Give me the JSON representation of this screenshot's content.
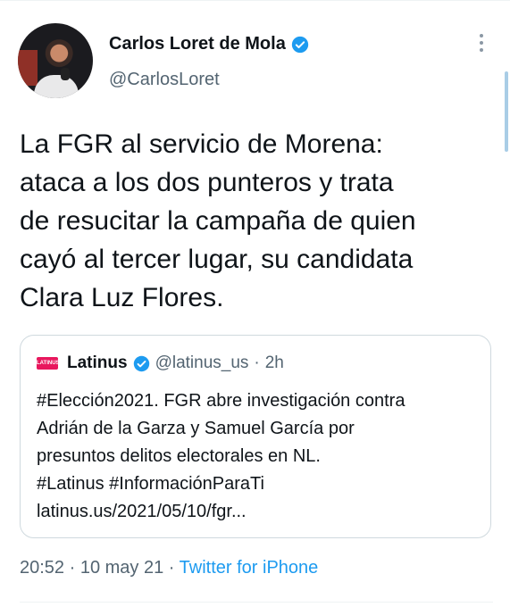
{
  "author": {
    "display_name": "Carlos Loret de Mola",
    "username": "@CarlosLoret",
    "verified_icon": "verified-badge-icon",
    "avatar_icon": "avatar"
  },
  "tweet": {
    "text": "La FGR al servicio de Morena:\nataca a los dos punteros y trata\nde resucitar la campaña de quien\ncayó al tercer lugar, su candidata\nClara Luz Flores."
  },
  "quoted_tweet": {
    "logo_text": "LATINUS",
    "name": "Latinus",
    "username": "@latinus_us",
    "separator": "·",
    "time": "2h",
    "text": "#Elección2021. FGR abre investigación contra\nAdrián de la Garza y Samuel García por\npresuntos delitos electorales en NL.\n#Latinus #InformaciónParaTi\nlatinus.us/2021/05/10/fgr..."
  },
  "meta": {
    "time": "20:52",
    "separator1": " · ",
    "date": "10 may 21",
    "separator2": " · ",
    "source": "Twitter for iPhone"
  },
  "colors": {
    "accent": "#1d9bf0",
    "secondary_text": "#536471",
    "border": "#cfd9de",
    "latinus_brand": "#e8175d"
  }
}
